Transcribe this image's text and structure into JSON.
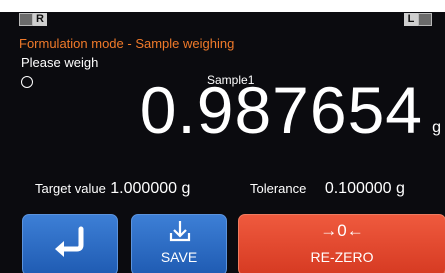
{
  "status": {
    "left_indicator": "R",
    "right_indicator": "L"
  },
  "mode": {
    "title": "Formulation mode - Sample weighing",
    "prompt": "Please weigh"
  },
  "measurement": {
    "sample_name": "Sample1",
    "value": "0.987654",
    "unit": "g"
  },
  "target": {
    "label": "Target value",
    "value": "1.000000 g"
  },
  "tolerance": {
    "label": "Tolerance",
    "value": "0.100000 g"
  },
  "buttons": {
    "back": {
      "icon": "return-arrow-icon"
    },
    "save": {
      "label": "SAVE",
      "icon": "download-tray-icon"
    },
    "rezero": {
      "label": "RE-ZERO",
      "glyph": "→0←"
    }
  },
  "colors": {
    "background": "#0b0b0f",
    "mode_text": "#f07a2a",
    "button_blue": "#2a6cc6",
    "button_red": "#e2482e"
  }
}
